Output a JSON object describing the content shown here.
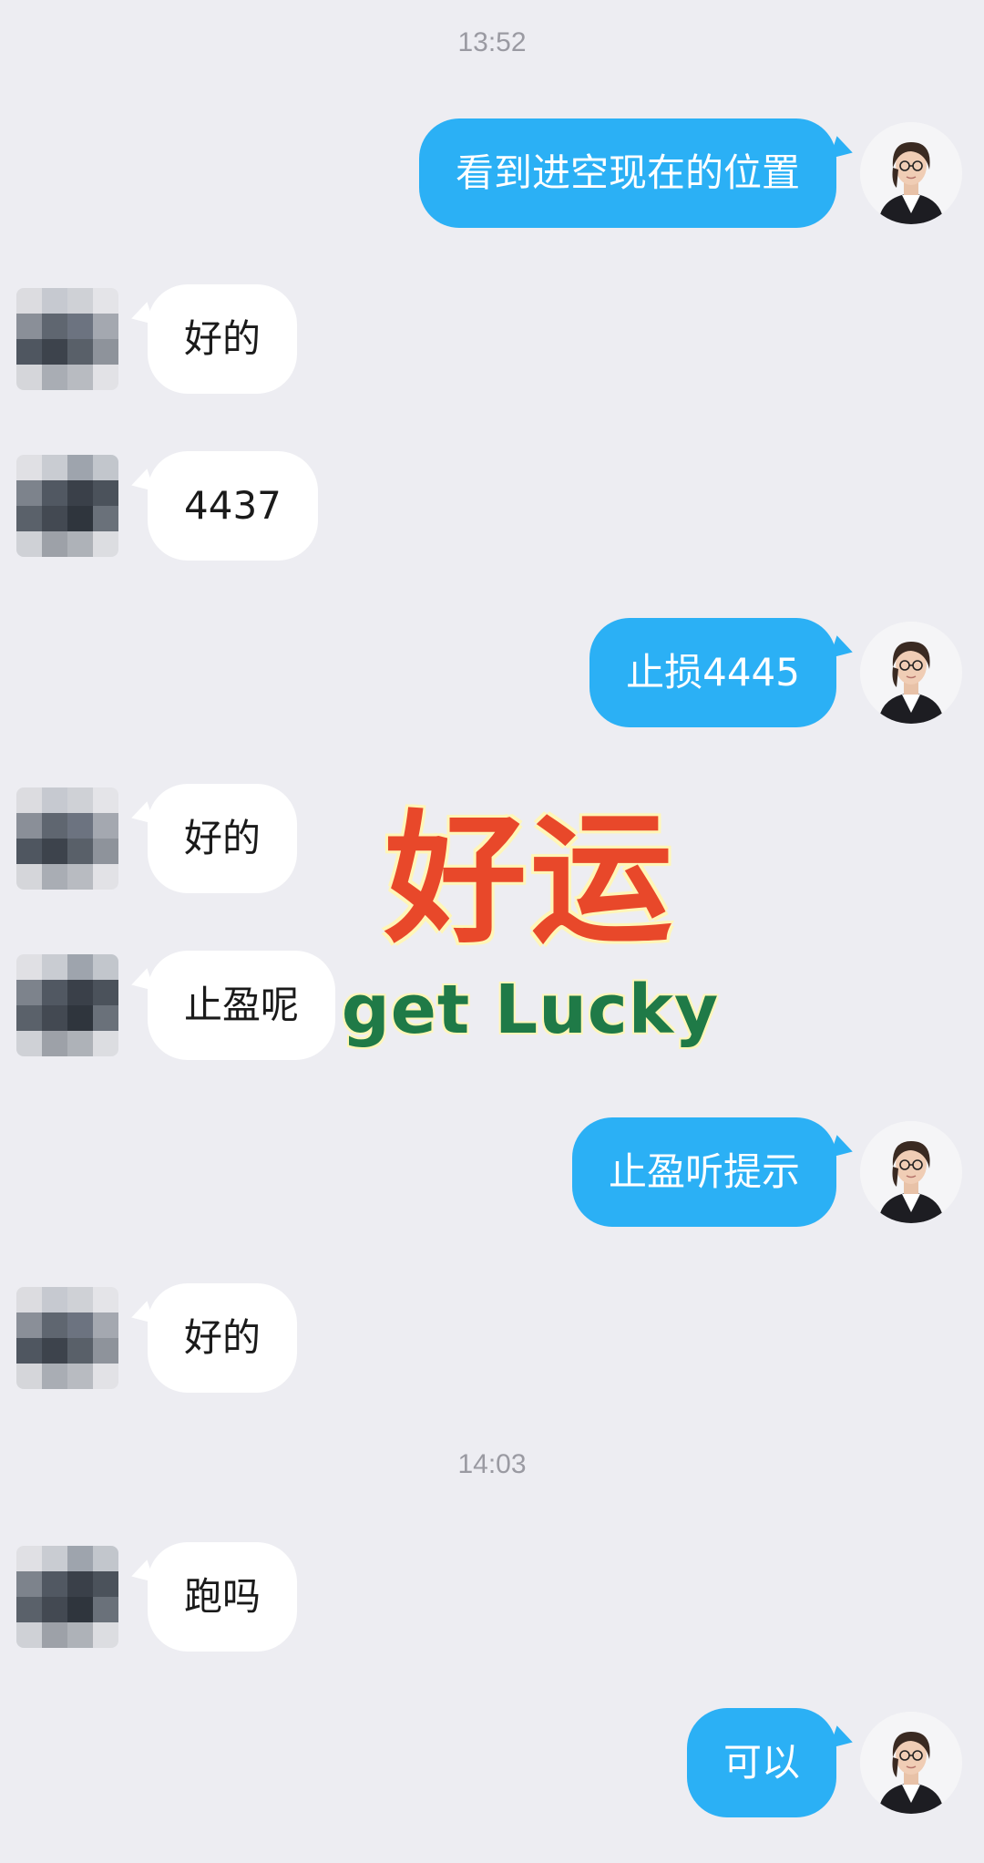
{
  "timestamps": [
    "13:52",
    "14:03"
  ],
  "messages": [
    {
      "side": "out",
      "text": "看到进空现在的位置"
    },
    {
      "side": "in",
      "text": "好的"
    },
    {
      "side": "in",
      "text": "4437"
    },
    {
      "side": "out",
      "text": "止损4445"
    },
    {
      "side": "in",
      "text": "好的"
    },
    {
      "side": "in",
      "text": "止盈呢"
    },
    {
      "side": "out",
      "text": "止盈听提示"
    },
    {
      "side": "in",
      "text": "好的"
    },
    {
      "side": "in",
      "text": "跑吗"
    },
    {
      "side": "out",
      "text": "可以"
    }
  ],
  "sticker": {
    "title": "好运",
    "subtitle": "get Lucky"
  },
  "colors": {
    "background": "#ededf2",
    "outgoing_bubble": "#2bb0f5",
    "incoming_bubble": "#ffffff",
    "sticker_red": "#e8482a",
    "sticker_green": "#1f7a47"
  }
}
